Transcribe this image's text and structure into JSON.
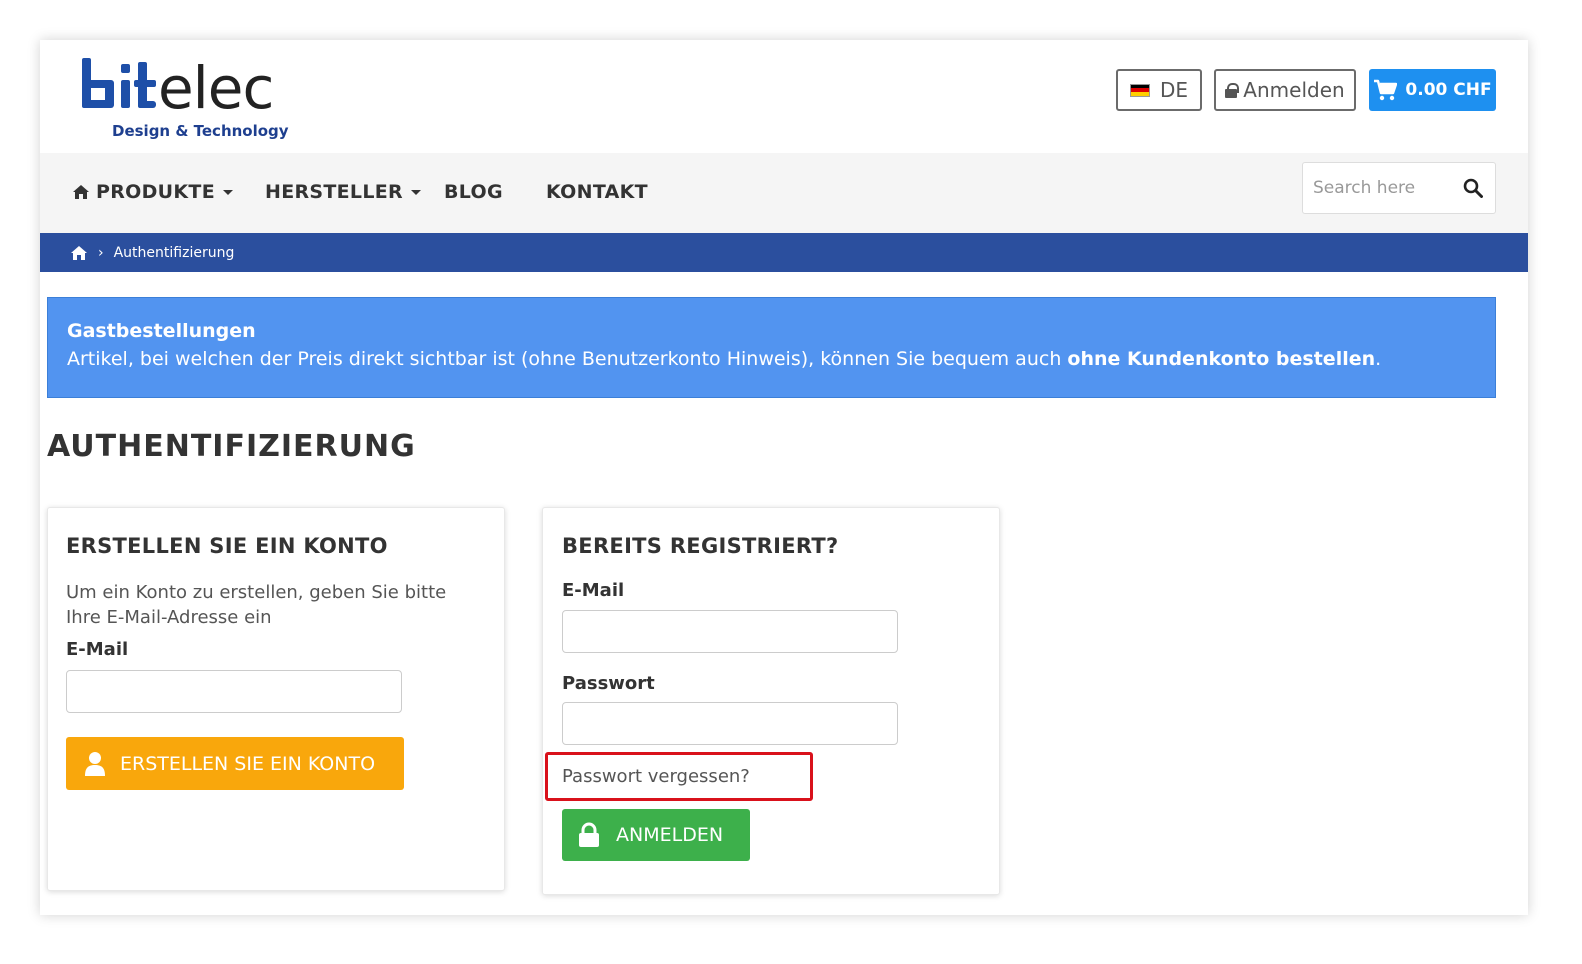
{
  "header": {
    "logo_text": "bitelec",
    "logo_tagline": "Design & Technology",
    "language_label": "DE",
    "login_label": "Anmelden",
    "cart_total": "0.00 CHF"
  },
  "nav": {
    "items": [
      {
        "label": "PRODUKTE"
      },
      {
        "label": "HERSTELLER"
      },
      {
        "label": "BLOG"
      },
      {
        "label": "KONTAKT"
      }
    ],
    "search_placeholder": "Search here"
  },
  "breadcrumb": {
    "current": "Authentifizierung",
    "separator": "›"
  },
  "alert": {
    "title": "Gastbestellungen",
    "text_before": "Artikel, bei welchen der Preis direkt sichtbar ist (ohne Benutzerkonto Hinweis), können Sie bequem auch ",
    "text_bold": "ohne Kundenkonto bestellen",
    "text_after": "."
  },
  "page": {
    "title": "AUTHENTIFIZIERUNG"
  },
  "create_account": {
    "title": "ERSTELLEN SIE EIN KONTO",
    "description": "Um ein Konto zu erstellen, geben Sie bitte Ihre E-Mail-Adresse ein",
    "email_label": "E-Mail",
    "email_value": "",
    "button_label": "ERSTELLEN SIE EIN KONTO"
  },
  "login": {
    "title": "BEREITS REGISTRIERT?",
    "email_label": "E-Mail",
    "email_value": "",
    "password_label": "Passwort",
    "password_value": "",
    "forgot_password": "Passwort vergessen?",
    "button_label": "ANMELDEN"
  },
  "colors": {
    "brand_blue": "#1e3f8f",
    "cart_blue": "#1e90f0",
    "breadcrumb_bg": "#2b4f9e",
    "alert_bg": "#5294f0",
    "create_orange": "#f9a70c",
    "login_green": "#3db04b",
    "highlight_red": "#d9111b"
  },
  "icons": {
    "home": "home-icon",
    "search": "search-icon",
    "cart": "cart-icon",
    "lock": "lock-icon",
    "user": "user-icon",
    "flag": "german-flag-icon"
  }
}
